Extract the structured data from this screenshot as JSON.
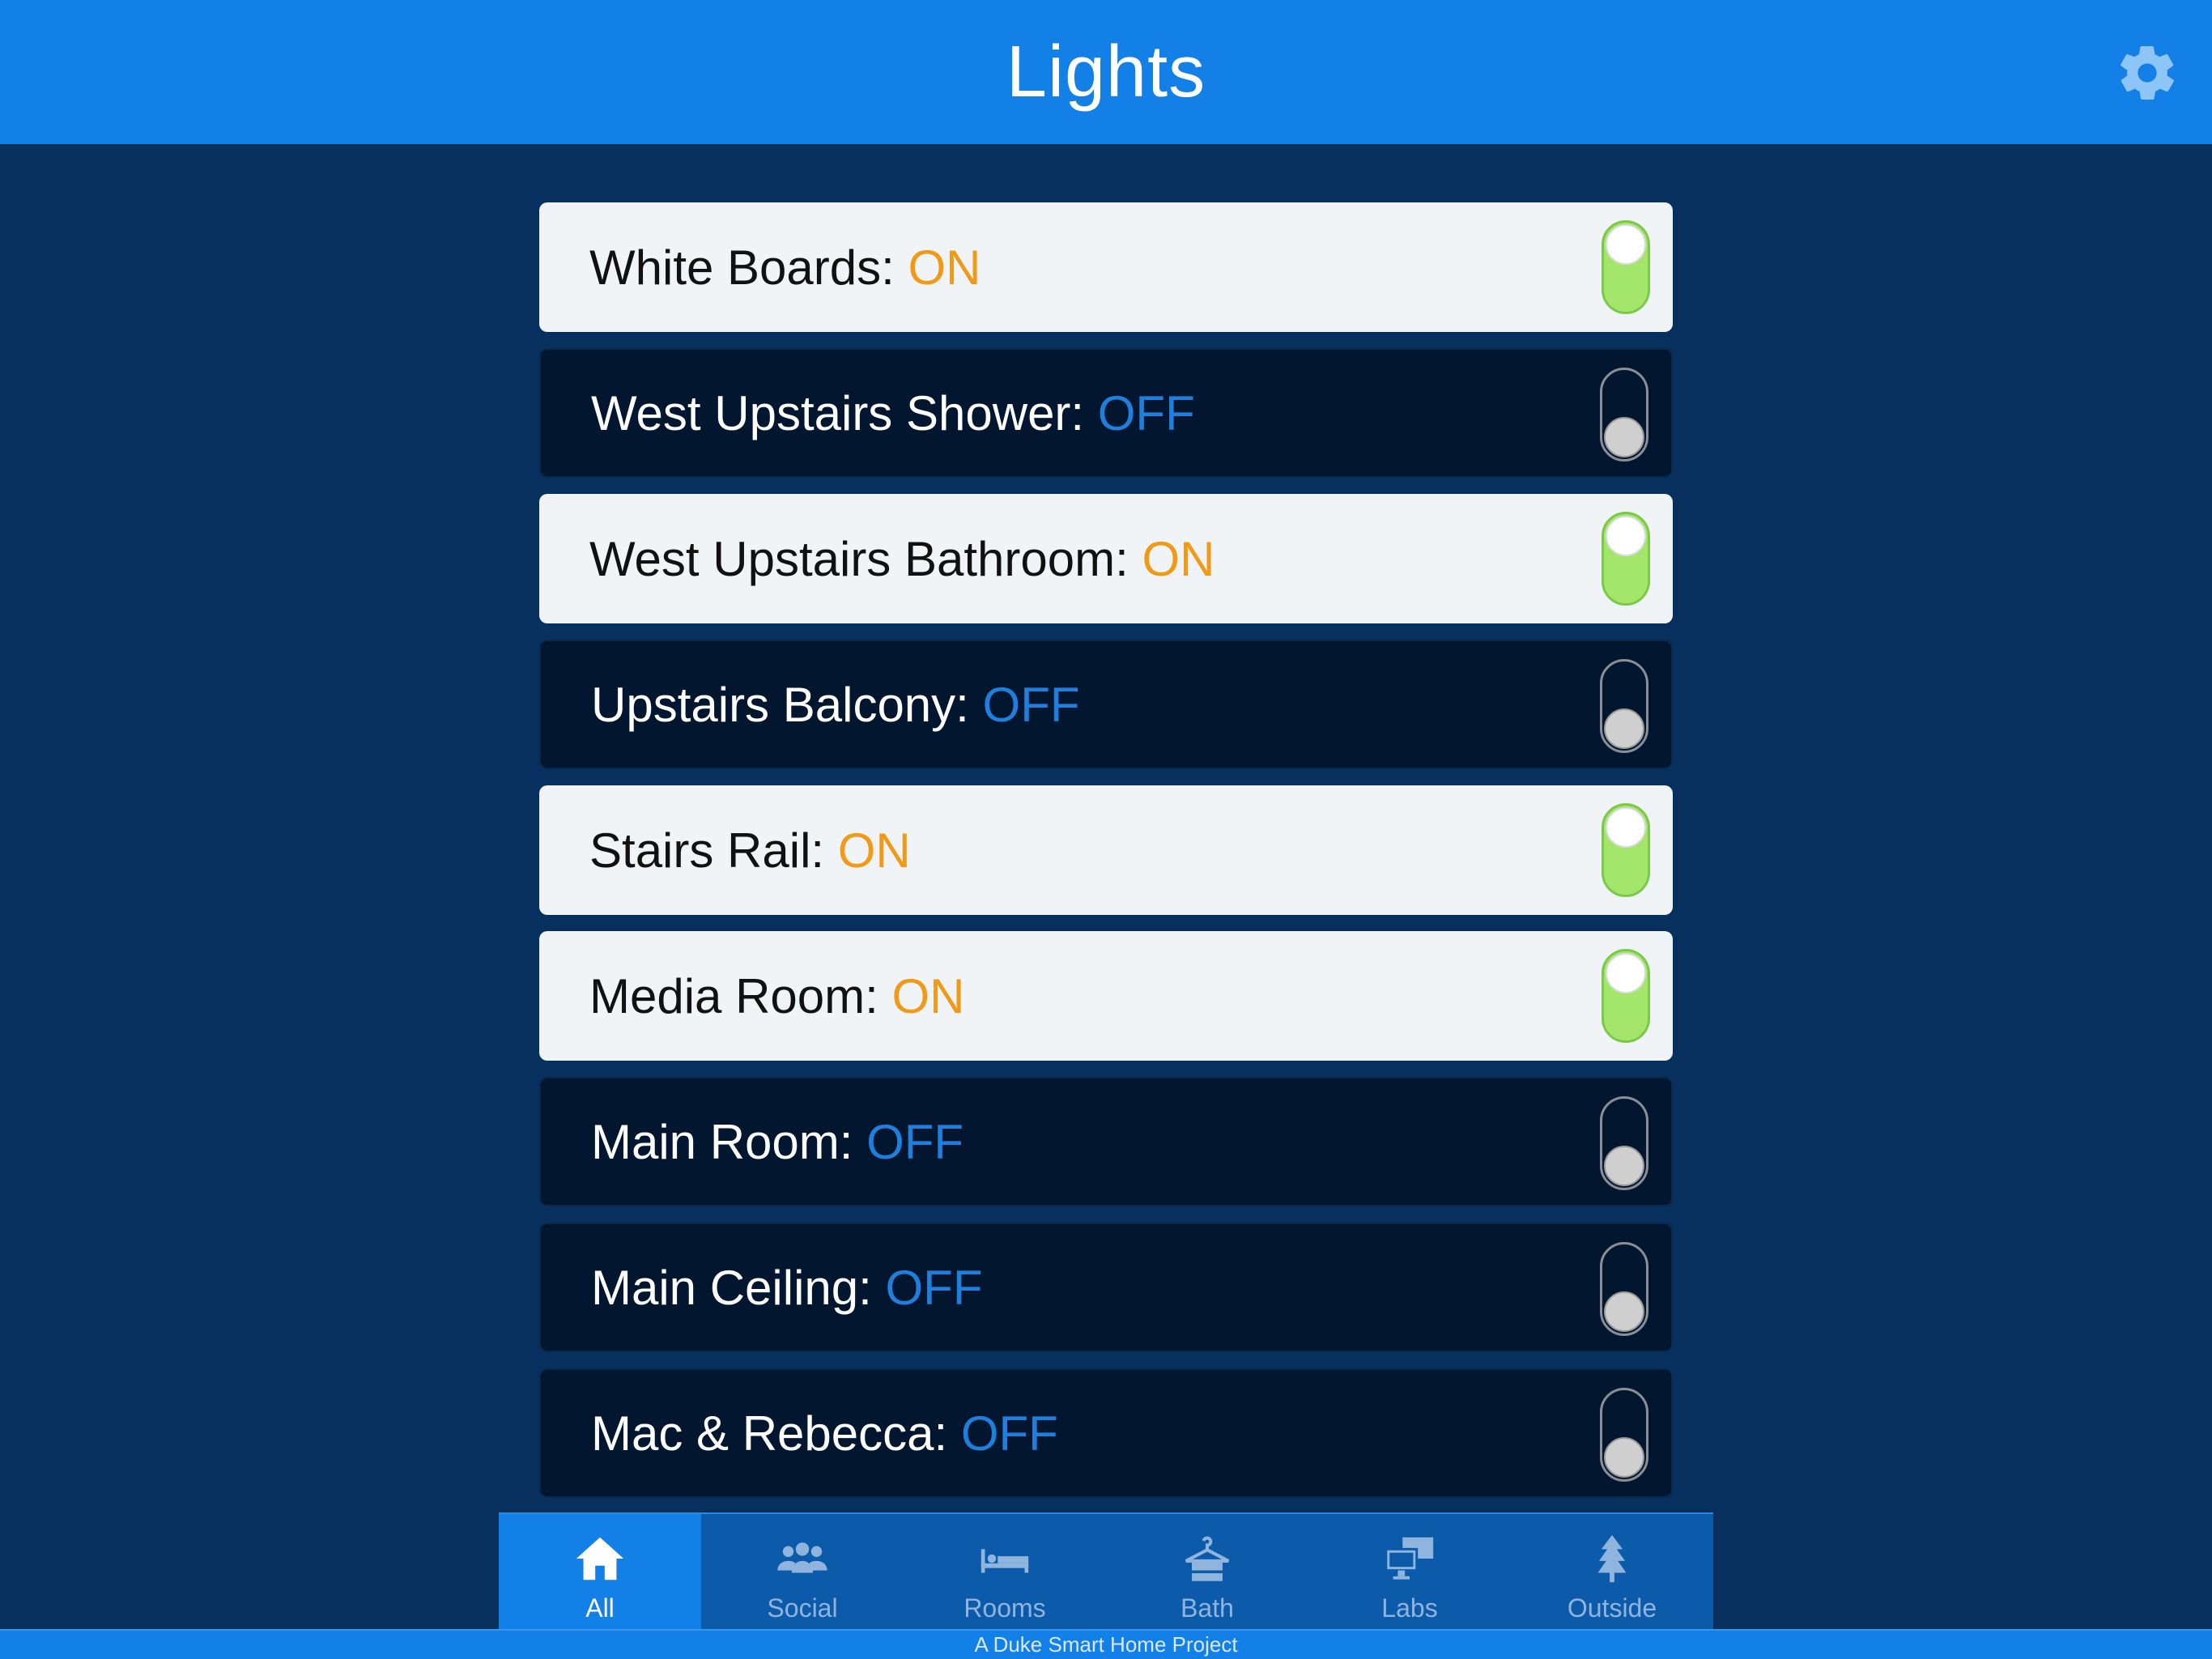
{
  "header": {
    "title": "Lights",
    "settings_icon": "gear-icon"
  },
  "colors": {
    "header_bg": "#1380e8",
    "page_bg": "#07305e",
    "on_text": "#f19a17",
    "off_text": "#1e7fdc",
    "toggle_on": "#a4e66c"
  },
  "lights": [
    {
      "name": "White Boards:",
      "state": "ON",
      "on": true
    },
    {
      "name": "West Upstairs Shower:",
      "state": "OFF",
      "on": false
    },
    {
      "name": "West Upstairs Bathroom:",
      "state": "ON",
      "on": true
    },
    {
      "name": "Upstairs Balcony:",
      "state": "OFF",
      "on": false
    },
    {
      "name": "Stairs Rail:",
      "state": "ON",
      "on": true
    },
    {
      "name": "Media Room:",
      "state": "ON",
      "on": true
    },
    {
      "name": "Main Room:",
      "state": "OFF",
      "on": false
    },
    {
      "name": "Main Ceiling:",
      "state": "OFF",
      "on": false
    },
    {
      "name": "Mac & Rebecca:",
      "state": "OFF",
      "on": false
    }
  ],
  "tabs": [
    {
      "label": "All",
      "icon": "home-icon",
      "active": true
    },
    {
      "label": "Social",
      "icon": "people-icon",
      "active": false
    },
    {
      "label": "Rooms",
      "icon": "bed-icon",
      "active": false
    },
    {
      "label": "Bath",
      "icon": "hanger-icon",
      "active": false
    },
    {
      "label": "Labs",
      "icon": "computer-icon",
      "active": false
    },
    {
      "label": "Outside",
      "icon": "tree-icon",
      "active": false
    }
  ],
  "footer": {
    "text": "A Duke Smart Home Project"
  }
}
